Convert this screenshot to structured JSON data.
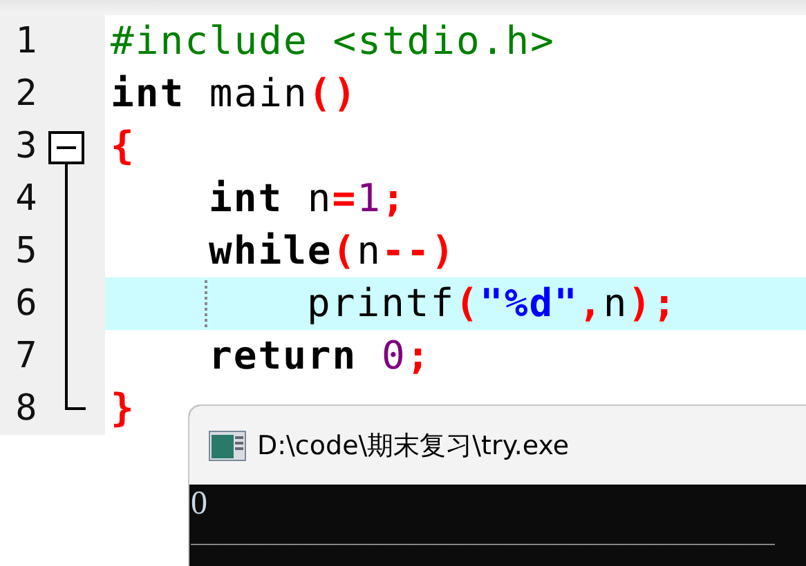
{
  "editor": {
    "lines": [
      {
        "number": "1",
        "highlighted": false,
        "tokens": [
          {
            "kind": "preprocessor",
            "text": "#include <stdio.h>"
          }
        ]
      },
      {
        "number": "2",
        "highlighted": false,
        "tokens": [
          {
            "kind": "keyword",
            "text": "int"
          },
          {
            "kind": "plain",
            "text": " main"
          },
          {
            "kind": "punct",
            "text": "()"
          }
        ]
      },
      {
        "number": "3",
        "highlighted": false,
        "expanded": true,
        "tokens": [
          {
            "kind": "punct",
            "text": "{"
          }
        ],
        "children": [
          {
            "number": "4",
            "highlighted": false,
            "tokens": [
              {
                "kind": "keyword",
                "text": "int"
              },
              {
                "kind": "plain",
                "text": " n"
              },
              {
                "kind": "punct",
                "text": "="
              },
              {
                "kind": "number",
                "text": "1"
              },
              {
                "kind": "punct",
                "text": ";"
              }
            ]
          },
          {
            "number": "5",
            "highlighted": false,
            "tokens": [
              {
                "kind": "keyword",
                "text": "while"
              },
              {
                "kind": "punct",
                "text": "("
              },
              {
                "kind": "plain",
                "text": "n"
              },
              {
                "kind": "punct",
                "text": "--)"
              }
            ],
            "children": [
              {
                "number": "6",
                "highlighted": true,
                "tokens": [
                  {
                    "kind": "plain",
                    "text": "printf"
                  },
                  {
                    "kind": "punct",
                    "text": "("
                  },
                  {
                    "kind": "string",
                    "text": "\"%d\""
                  },
                  {
                    "kind": "punct",
                    "text": ","
                  },
                  {
                    "kind": "plain",
                    "text": "n"
                  },
                  {
                    "kind": "punct",
                    "text": ");"
                  }
                ]
              }
            ]
          },
          {
            "number": "7",
            "highlighted": false,
            "tokens": [
              {
                "kind": "keyword",
                "text": "return"
              },
              {
                "kind": "number",
                "text": " 0"
              },
              {
                "kind": "punct",
                "text": ";"
              }
            ]
          }
        ]
      },
      {
        "number": "8",
        "highlighted": false,
        "tokens": [
          {
            "kind": "punct",
            "text": "}"
          }
        ]
      }
    ]
  },
  "console": {
    "title": "D:\\code\\期末复习\\try.exe",
    "output": [
      "0",
      "____________________________________________"
    ]
  }
}
